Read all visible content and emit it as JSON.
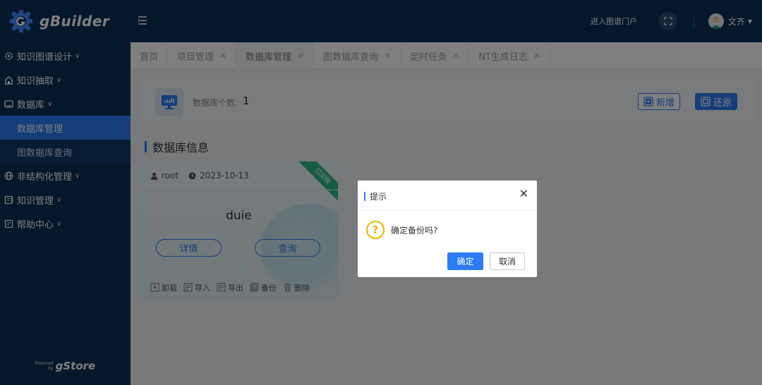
{
  "app": {
    "brand": "gBuilder",
    "powered_small_1": "Powered",
    "powered_small_2": "by",
    "powered_brand": "gStore"
  },
  "header": {
    "portal_link": "进入图谱门户",
    "user_name": "文齐"
  },
  "sidebar": {
    "items": [
      {
        "label": "知识图谱设计",
        "icon": "gear-icon"
      },
      {
        "label": "知识抽取",
        "icon": "building-icon"
      },
      {
        "label": "数据库",
        "icon": "database-icon"
      },
      {
        "label": "非结构化管理",
        "icon": "globe-icon"
      },
      {
        "label": "知识管理",
        "icon": "book-icon"
      },
      {
        "label": "帮助中心",
        "icon": "help-icon"
      }
    ],
    "subitems": [
      {
        "label": "数据库管理",
        "active": true
      },
      {
        "label": "图数据库查询",
        "active": false
      }
    ]
  },
  "tabs": [
    {
      "label": "首页"
    },
    {
      "label": "项目管理"
    },
    {
      "label": "数据库管理"
    },
    {
      "label": "图数据库查询"
    },
    {
      "label": "定时任务"
    },
    {
      "label": "NT生成日志"
    }
  ],
  "stats": {
    "count_label": "数据库个数:",
    "count_value": "1",
    "add_label": "新增",
    "restore_label": "还原"
  },
  "section": {
    "title": "数据库信息"
  },
  "card": {
    "user": "root",
    "date": "2023-10-13",
    "ribbon": "已加载",
    "name": "duie",
    "detail_label": "详情",
    "query_label": "查询",
    "actions": [
      "卸载",
      "导入",
      "导出",
      "备份",
      "删除"
    ]
  },
  "dialog": {
    "title": "提示",
    "message": "确定备份吗?",
    "ok_label": "确定",
    "cancel_label": "取消"
  },
  "colors": {
    "sidebar_bg": "#0b2e57",
    "accent": "#2b7cf6",
    "ribbon": "#2fb889",
    "warning": "#f0b400"
  }
}
